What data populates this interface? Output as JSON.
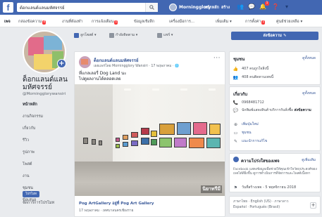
{
  "topbar": {
    "logo": "f",
    "search_value": "ต้อกแลนด์แลนมหัศจรรย์",
    "user_name": "Morningglory",
    "links": [
      "หน้าหลัก",
      "สร้าง"
    ],
    "notification_badge": "1"
  },
  "tabs": [
    {
      "label": "เพจ",
      "active": true
    },
    {
      "label": "กล่องข้อความ",
      "badge": "4"
    },
    {
      "label": "งานที่ต้องทำ"
    },
    {
      "label": "การแจ้งเตือน",
      "badge": "1"
    },
    {
      "label": "ข้อมูลเชิงลึก"
    },
    {
      "label": "เครื่องมือการ..."
    },
    {
      "label": "เพิ่มเติม ▾"
    },
    {
      "label": "การตั้งค่า",
      "badge": "1"
    },
    {
      "label": "ศูนย์ช่วยเหลือ ▾"
    }
  ],
  "left": {
    "page_name": "ด็อกแลนด์แลนมหัศจรรย์",
    "page_handle": "@Morningglorywansiri",
    "nav": [
      "หน้าหลัก",
      "งานกิจกรรม",
      "เกี่ยวกับ",
      "รีวิว",
      "รูปภาพ",
      "โพสต์",
      "งาน",
      "ชุมชน",
      "ข้อเสนอ"
    ],
    "promote_button": "โปรโมท",
    "manage_link": "จัดการการโปรโมท"
  },
  "composer": {
    "posts_button": "ลูกโพสต์ ▾",
    "activity_button": "กำลังติดตาม ▾",
    "share_button": "แชร์ ▾"
  },
  "post": {
    "author": "ด็อกแลนด์แลนมหัศจรรย์",
    "meta": "เผยแพร่โดย Morningglory Wansiri · 17 พฤษภาคม · 🌐",
    "text_line1": "ที่แกลเลอรี่ Dog Land นะ",
    "text_line2": "ไปดูผลงานได้ตลอดเลย",
    "more": "···",
    "watermark": "นิยาทรีมี",
    "footer_title": "Pog ArtGallery อยู่ที่ Pog Art Gallery",
    "footer_sub": "17 พฤษภาคม · เทศบาลนครเชียงราย"
  },
  "right": {
    "cta_button": "ส่งข้อความ ✎",
    "community": {
      "title": "ชุมชน",
      "link": "ดูทั้งหมด",
      "rows": [
        "407 คนถูกใจสิ่งนี้",
        "408 คนติดตามเพจนี้"
      ]
    },
    "about": {
      "title": "เกี่ยวกับ",
      "link": "ดูทั้งหมด",
      "phone": "0968481712",
      "category_prefix": "นักพิมพ์แสดงสินค้าบริการรับสั่งซื้อ",
      "category_bold": "ส่งข้อความ",
      "add_button": "เพิ่มปุ่มใหม่",
      "type": "ชุมชน",
      "edit": "แนะนำการแก้ไข"
    },
    "privacy": {
      "title": "ความโปร่งใสของเพจ",
      "link": "ดูเพิ่มเติม",
      "text": "Facebook แสดงข้อมูลเพื่อช่วยให้คุณเข้าใจวัตถุประสงค์ของเพจได้ดียิ่งขึ้น ดูการดำเนินการที่จัดการและโพสต์เนื้อหา",
      "created": "วันที่สร้างเพจ - 5 พฤศจิกายน 2018"
    },
    "languages": {
      "line1": "ภาษาไทย · English (US) · ภาษาลาว",
      "line2": "Español · Português (Brasil)",
      "add": "+"
    }
  },
  "colors": {
    "brand_blue": "#4267b2",
    "link_blue": "#385898",
    "badge_red": "#fa3e3e",
    "page_bg": "#e9ebee"
  }
}
